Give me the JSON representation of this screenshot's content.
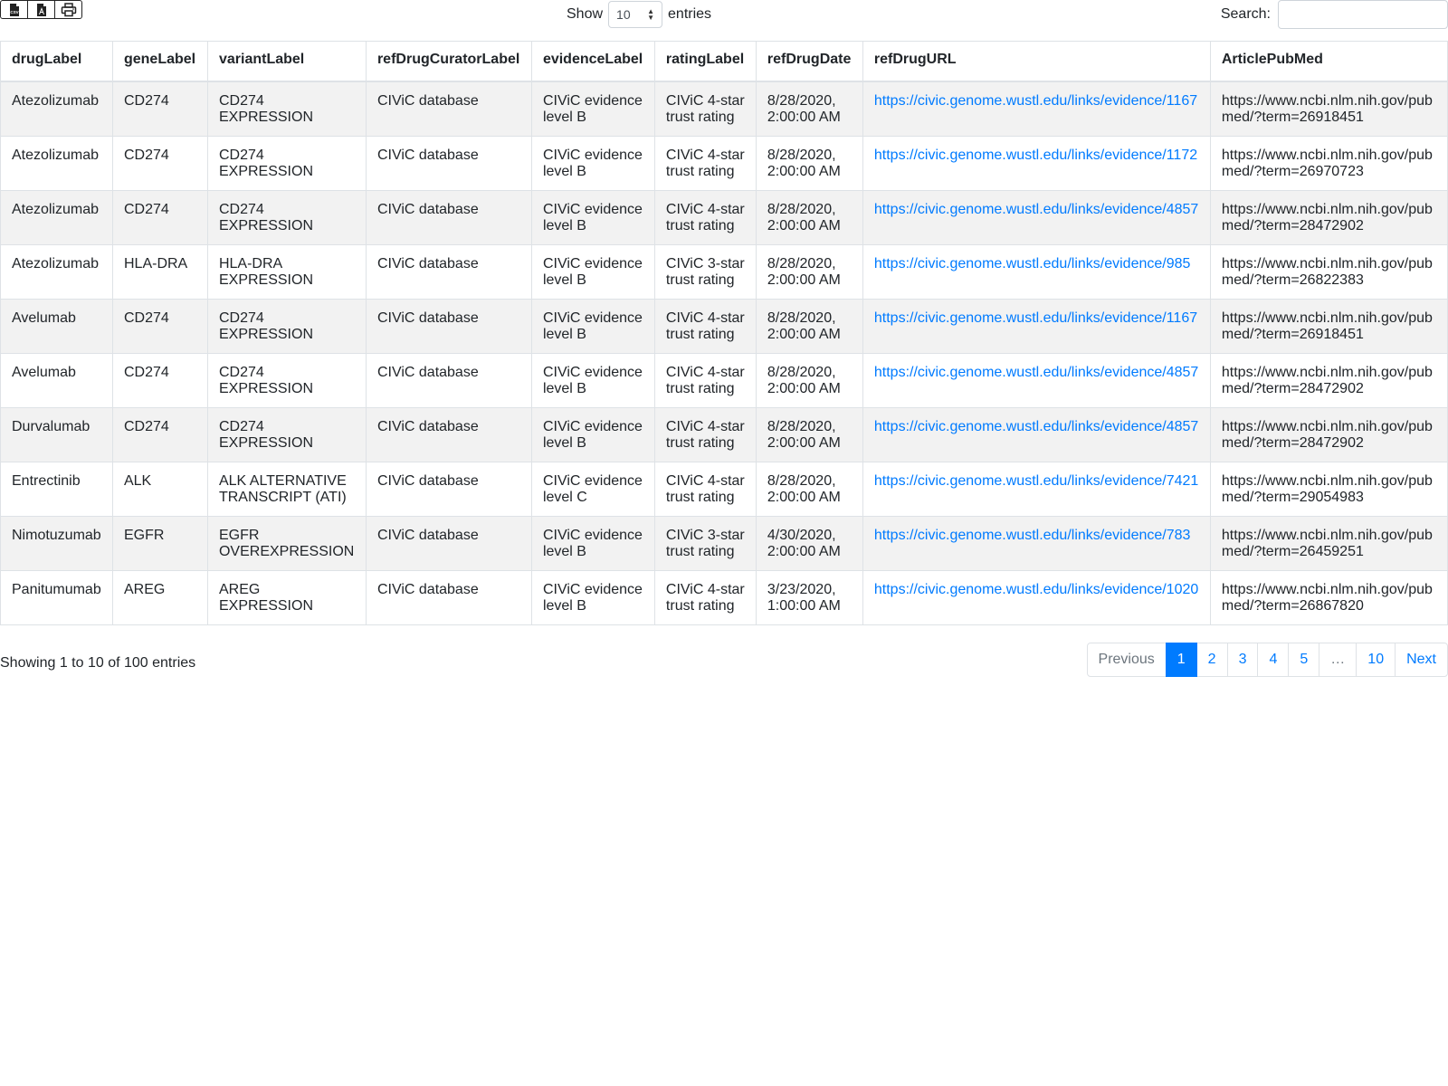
{
  "toolbar": {
    "icons": [
      "csv-icon",
      "pdf-icon",
      "print-icon"
    ]
  },
  "length": {
    "show_label": "Show",
    "value": "10",
    "entries_label": "entries"
  },
  "search": {
    "label": "Search:",
    "value": ""
  },
  "table": {
    "columns": [
      "drugLabel",
      "geneLabel",
      "variantLabel",
      "refDrugCuratorLabel",
      "evidenceLabel",
      "ratingLabel",
      "refDrugDate",
      "refDrugURL",
      "ArticlePubMed"
    ],
    "rows": [
      [
        "Atezolizumab",
        "CD274",
        "CD274 EXPRESSION",
        "CIViC database",
        "CIViC evidence level B",
        "CIViC 4-star trust rating",
        "8/28/2020, 2:00:00 AM",
        "https://civic.genome.wustl.edu/links/evidence/1167",
        "https://www.ncbi.nlm.nih.gov/pubmed/?term=26918451"
      ],
      [
        "Atezolizumab",
        "CD274",
        "CD274 EXPRESSION",
        "CIViC database",
        "CIViC evidence level B",
        "CIViC 4-star trust rating",
        "8/28/2020, 2:00:00 AM",
        "https://civic.genome.wustl.edu/links/evidence/1172",
        "https://www.ncbi.nlm.nih.gov/pubmed/?term=26970723"
      ],
      [
        "Atezolizumab",
        "CD274",
        "CD274 EXPRESSION",
        "CIViC database",
        "CIViC evidence level B",
        "CIViC 4-star trust rating",
        "8/28/2020, 2:00:00 AM",
        "https://civic.genome.wustl.edu/links/evidence/4857",
        "https://www.ncbi.nlm.nih.gov/pubmed/?term=28472902"
      ],
      [
        "Atezolizumab",
        "HLA-DRA",
        "HLA-DRA EXPRESSION",
        "CIViC database",
        "CIViC evidence level B",
        "CIViC 3-star trust rating",
        "8/28/2020, 2:00:00 AM",
        "https://civic.genome.wustl.edu/links/evidence/985",
        "https://www.ncbi.nlm.nih.gov/pubmed/?term=26822383"
      ],
      [
        "Avelumab",
        "CD274",
        "CD274 EXPRESSION",
        "CIViC database",
        "CIViC evidence level B",
        "CIViC 4-star trust rating",
        "8/28/2020, 2:00:00 AM",
        "https://civic.genome.wustl.edu/links/evidence/1167",
        "https://www.ncbi.nlm.nih.gov/pubmed/?term=26918451"
      ],
      [
        "Avelumab",
        "CD274",
        "CD274 EXPRESSION",
        "CIViC database",
        "CIViC evidence level B",
        "CIViC 4-star trust rating",
        "8/28/2020, 2:00:00 AM",
        "https://civic.genome.wustl.edu/links/evidence/4857",
        "https://www.ncbi.nlm.nih.gov/pubmed/?term=28472902"
      ],
      [
        "Durvalumab",
        "CD274",
        "CD274 EXPRESSION",
        "CIViC database",
        "CIViC evidence level B",
        "CIViC 4-star trust rating",
        "8/28/2020, 2:00:00 AM",
        "https://civic.genome.wustl.edu/links/evidence/4857",
        "https://www.ncbi.nlm.nih.gov/pubmed/?term=28472902"
      ],
      [
        "Entrectinib",
        "ALK",
        "ALK ALTERNATIVE TRANSCRIPT (ATI)",
        "CIViC database",
        "CIViC evidence level C",
        "CIViC 4-star trust rating",
        "8/28/2020, 2:00:00 AM",
        "https://civic.genome.wustl.edu/links/evidence/7421",
        "https://www.ncbi.nlm.nih.gov/pubmed/?term=29054983"
      ],
      [
        "Nimotuzumab",
        "EGFR",
        "EGFR OVEREXPRESSION",
        "CIViC database",
        "CIViC evidence level B",
        "CIViC 3-star trust rating",
        "4/30/2020, 2:00:00 AM",
        "https://civic.genome.wustl.edu/links/evidence/783",
        "https://www.ncbi.nlm.nih.gov/pubmed/?term=26459251"
      ],
      [
        "Panitumumab",
        "AREG",
        "AREG EXPRESSION",
        "CIViC database",
        "CIViC evidence level B",
        "CIViC 4-star trust rating",
        "3/23/2020, 1:00:00 AM",
        "https://civic.genome.wustl.edu/links/evidence/1020",
        "https://www.ncbi.nlm.nih.gov/pubmed/?term=26867820"
      ]
    ]
  },
  "info": "Showing 1 to 10 of 100 entries",
  "pagination": {
    "previous": "Previous",
    "pages": [
      "1",
      "2",
      "3",
      "4",
      "5",
      "…",
      "10"
    ],
    "active": "1",
    "next": "Next"
  },
  "colors": {
    "accent": "#007bff",
    "stripe": "#f2f2f2",
    "border": "#dee2e6"
  }
}
